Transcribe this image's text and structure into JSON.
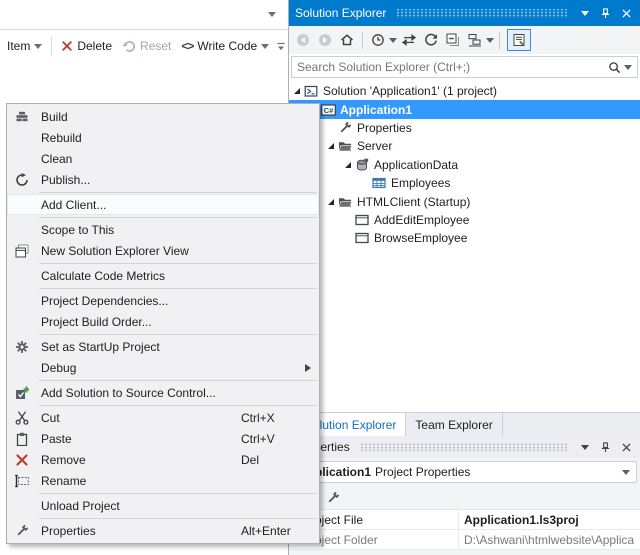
{
  "colors": {
    "titlebar_accent": "#007ACC",
    "tree_selection": "#3399FF",
    "active_tab_text": "#0E70C0",
    "delete_red": "#C0392B"
  },
  "left_pane": {
    "toolbar": {
      "item": "Item",
      "delete": "Delete",
      "reset": "Reset",
      "write_code": "Write Code"
    }
  },
  "context_menu": {
    "items": [
      {
        "label": "Build",
        "icon": "build-icon"
      },
      {
        "label": "Rebuild"
      },
      {
        "label": "Clean"
      },
      {
        "label": "Publish...",
        "icon": "publish-icon"
      },
      {
        "separator": true
      },
      {
        "label": "Add Client...",
        "hover": true
      },
      {
        "separator": true
      },
      {
        "label": "Scope to This"
      },
      {
        "label": "New Solution Explorer View",
        "icon": "new-solution-explorer-view-icon"
      },
      {
        "separator": true
      },
      {
        "label": "Calculate Code Metrics"
      },
      {
        "separator": true
      },
      {
        "label": "Project Dependencies..."
      },
      {
        "label": "Project Build Order..."
      },
      {
        "separator": true
      },
      {
        "label": "Set as StartUp Project",
        "icon": "gear-icon"
      },
      {
        "label": "Debug",
        "submenu": true
      },
      {
        "separator": true
      },
      {
        "label": "Add Solution to Source Control...",
        "icon": "source-control-icon"
      },
      {
        "separator": true
      },
      {
        "label": "Cut",
        "shortcut": "Ctrl+X",
        "icon": "cut-icon"
      },
      {
        "label": "Paste",
        "shortcut": "Ctrl+V",
        "icon": "paste-icon"
      },
      {
        "label": "Remove",
        "shortcut": "Del",
        "icon": "remove-icon"
      },
      {
        "label": "Rename",
        "icon": "rename-icon"
      },
      {
        "separator": true
      },
      {
        "label": "Unload Project"
      },
      {
        "separator": true
      },
      {
        "label": "Properties",
        "shortcut": "Alt+Enter",
        "icon": "wrench-icon"
      }
    ]
  },
  "solution_explorer": {
    "title": "Solution Explorer",
    "search_placeholder": "Search Solution Explorer (Ctrl+;)",
    "toolbar_icons": [
      "back-icon",
      "forward-icon",
      "home-icon",
      "pending-changes-icon",
      "sync-active-document-icon",
      "refresh-icon",
      "collapse-all-icon",
      "show-all-files-icon",
      "properties-window-icon"
    ],
    "tree": [
      {
        "label": "Solution 'Application1' (1 project)",
        "icon": "solution-icon",
        "indent": 0,
        "expanded": true
      },
      {
        "label": "Application1",
        "icon": "csharp-project-icon",
        "indent": 1,
        "expanded": true,
        "selected": true
      },
      {
        "label": "Properties",
        "icon": "wrench-icon",
        "indent": 2
      },
      {
        "label": "Server",
        "icon": "folder-icon",
        "indent": 2,
        "expanded": true
      },
      {
        "label": "ApplicationData",
        "icon": "database-icon",
        "indent": 3,
        "expanded": true
      },
      {
        "label": "Employees",
        "icon": "table-icon",
        "indent": 4
      },
      {
        "label": "HTMLClient (Startup)",
        "icon": "folder-icon",
        "indent": 2,
        "expanded": true
      },
      {
        "label": "AddEditEmployee",
        "icon": "screen-icon",
        "indent": 3
      },
      {
        "label": "BrowseEmployee",
        "icon": "screen-icon",
        "indent": 3
      }
    ]
  },
  "bottom_tabs": {
    "solution_explorer": "Solution Explorer",
    "team_explorer": "Team Explorer"
  },
  "properties_panel": {
    "title": "Properties",
    "object_name": "Application1",
    "object_type": "Project Properties",
    "rows": [
      {
        "name": "Project File",
        "value": "Application1.ls3proj"
      },
      {
        "name": "Project Folder",
        "value": "D:\\Ashwani\\htmlwebsite\\Applica"
      }
    ]
  }
}
